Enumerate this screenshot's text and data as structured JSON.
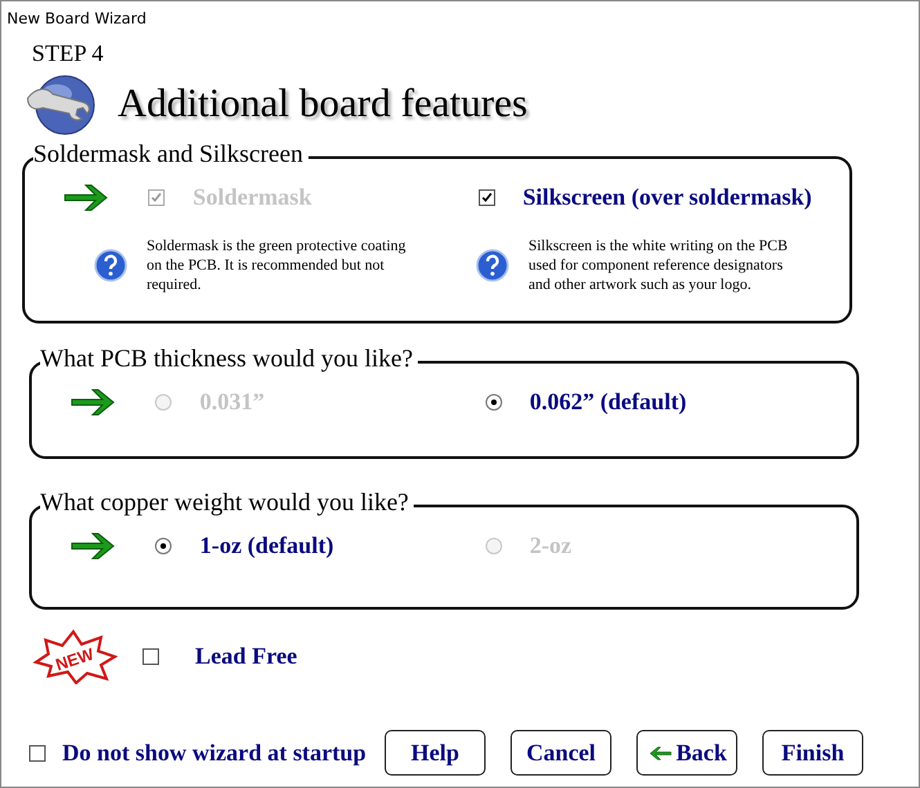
{
  "window": {
    "title": "New Board Wizard"
  },
  "step": "STEP 4",
  "heading": "Additional board features",
  "sections": [
    {
      "title": "Soldermask and Silkscreen",
      "kind": "checkbox",
      "options": [
        {
          "label": "Soldermask",
          "checked": true,
          "disabled": true,
          "help": "Soldermask is the green protective coating on the PCB. It is recommended but not required."
        },
        {
          "label": "Silkscreen (over soldermask)",
          "checked": true,
          "disabled": false,
          "help": "Silkscreen is the white writing on the PCB used for component reference designators and other artwork such as your logo."
        }
      ]
    },
    {
      "title": "What PCB thickness would you like?",
      "kind": "radio",
      "options": [
        {
          "label": "0.031”",
          "selected": false,
          "disabled": true
        },
        {
          "label": "0.062” (default)",
          "selected": true,
          "disabled": false
        }
      ]
    },
    {
      "title": "What copper weight would you like?",
      "kind": "radio",
      "options": [
        {
          "label": "1-oz (default)",
          "selected": true,
          "disabled": false
        },
        {
          "label": "2-oz",
          "selected": false,
          "disabled": true
        }
      ]
    }
  ],
  "lead_free": {
    "badge": "NEW",
    "label": "Lead Free",
    "checked": false
  },
  "startup": {
    "label": "Do not show wizard at startup",
    "checked": false
  },
  "buttons": [
    {
      "label": "Help",
      "kind": "plain"
    },
    {
      "label": "Cancel",
      "kind": "plain"
    },
    {
      "label": "Back",
      "kind": "back"
    },
    {
      "label": "Finish",
      "kind": "plain"
    }
  ]
}
